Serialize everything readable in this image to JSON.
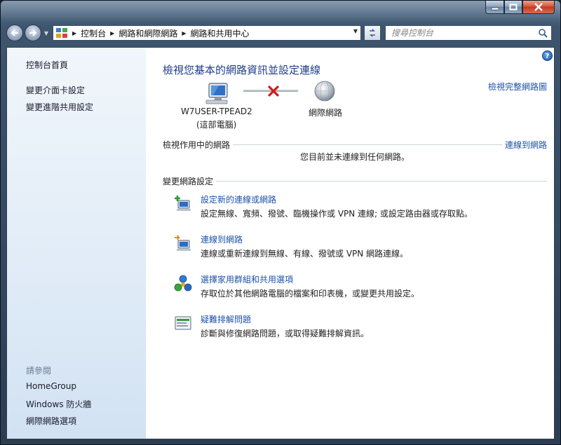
{
  "window": {
    "minimize_label": "minimize",
    "maximize_label": "maximize",
    "close_label": "close"
  },
  "address_bar": {
    "breadcrumbs": [
      "控制台",
      "網路和網際網路",
      "網路和共用中心"
    ]
  },
  "search": {
    "placeholder": "搜尋控制台"
  },
  "sidebar": {
    "home": "控制台首頁",
    "adapter_settings": "變更介面卡設定",
    "advanced_sharing": "變更進階共用設定",
    "see_also": "請參閱",
    "links": [
      "HomeGroup",
      "Windows 防火牆",
      "網際網路選項"
    ]
  },
  "main": {
    "title": "檢視您基本的網路資訊並設定連線",
    "full_map_link": "檢視完整網路圖",
    "computer_name": "W7USER-TPEAD2",
    "computer_sub": "(這部電腦)",
    "internet_label": "網際網路",
    "active_networks": {
      "title": "檢視作用中的網路",
      "connect_link": "連線到網路",
      "status": "您目前並未連線到任何網路。"
    },
    "change_settings": {
      "title": "變更網路設定",
      "tasks": [
        {
          "link": "設定新的連線或網路",
          "desc": "設定無線、寬頻、撥號、臨機操作或 VPN 連線; 或設定路由器或存取點。",
          "icon": "new-connection-icon"
        },
        {
          "link": "連線到網路",
          "desc": "連線或重新連線到無線、有線、撥號或 VPN 網路連線。",
          "icon": "connect-network-icon"
        },
        {
          "link": "選擇家用群組和共用選項",
          "desc": "存取位於其他網路電腦的檔案和印表機，或變更共用設定。",
          "icon": "homegroup-icon"
        },
        {
          "link": "疑難排解問題",
          "desc": "診斷與修復網路問題，或取得疑難排解資訊。",
          "icon": "troubleshoot-icon"
        }
      ]
    }
  },
  "colors": {
    "link": "#1f52a8",
    "title": "#1e3d8a",
    "sidebar_top": "#f0f6fb",
    "sidebar_bottom": "#d2e2f3",
    "error_x": "#d11a1a"
  }
}
